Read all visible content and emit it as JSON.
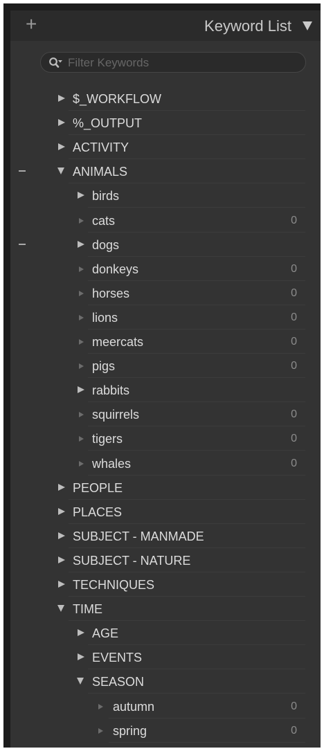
{
  "header": {
    "add_symbol": "+",
    "title": "Keyword List"
  },
  "search": {
    "placeholder": "Filter Keywords"
  },
  "keywords": [
    {
      "label": "$_WORKFLOW",
      "count": "",
      "depth": 0,
      "state": "collapsed",
      "collapse_mark": false
    },
    {
      "label": "%_OUTPUT",
      "count": "",
      "depth": 0,
      "state": "collapsed",
      "collapse_mark": false
    },
    {
      "label": "ACTIVITY",
      "count": "",
      "depth": 0,
      "state": "collapsed",
      "collapse_mark": false
    },
    {
      "label": "ANIMALS",
      "count": "",
      "depth": 0,
      "state": "expanded",
      "collapse_mark": true
    },
    {
      "label": "birds",
      "count": "",
      "depth": 1,
      "state": "collapsed",
      "collapse_mark": false
    },
    {
      "label": "cats",
      "count": "0",
      "depth": 1,
      "state": "leaf",
      "collapse_mark": false
    },
    {
      "label": "dogs",
      "count": "",
      "depth": 1,
      "state": "collapsed",
      "collapse_mark": true
    },
    {
      "label": "donkeys",
      "count": "0",
      "depth": 1,
      "state": "leaf",
      "collapse_mark": false
    },
    {
      "label": "horses",
      "count": "0",
      "depth": 1,
      "state": "leaf",
      "collapse_mark": false
    },
    {
      "label": "lions",
      "count": "0",
      "depth": 1,
      "state": "leaf",
      "collapse_mark": false
    },
    {
      "label": "meercats",
      "count": "0",
      "depth": 1,
      "state": "leaf",
      "collapse_mark": false
    },
    {
      "label": "pigs",
      "count": "0",
      "depth": 1,
      "state": "leaf",
      "collapse_mark": false
    },
    {
      "label": "rabbits",
      "count": "",
      "depth": 1,
      "state": "collapsed",
      "collapse_mark": false
    },
    {
      "label": "squirrels",
      "count": "0",
      "depth": 1,
      "state": "leaf",
      "collapse_mark": false
    },
    {
      "label": "tigers",
      "count": "0",
      "depth": 1,
      "state": "leaf",
      "collapse_mark": false
    },
    {
      "label": "whales",
      "count": "0",
      "depth": 1,
      "state": "leaf",
      "collapse_mark": false
    },
    {
      "label": "PEOPLE",
      "count": "",
      "depth": 0,
      "state": "collapsed",
      "collapse_mark": false
    },
    {
      "label": "PLACES",
      "count": "",
      "depth": 0,
      "state": "collapsed",
      "collapse_mark": false
    },
    {
      "label": "SUBJECT - MANMADE",
      "count": "",
      "depth": 0,
      "state": "collapsed",
      "collapse_mark": false
    },
    {
      "label": "SUBJECT - NATURE",
      "count": "",
      "depth": 0,
      "state": "collapsed",
      "collapse_mark": false
    },
    {
      "label": "TECHNIQUES",
      "count": "",
      "depth": 0,
      "state": "collapsed",
      "collapse_mark": false
    },
    {
      "label": "TIME",
      "count": "",
      "depth": 0,
      "state": "expanded",
      "collapse_mark": false
    },
    {
      "label": "AGE",
      "count": "",
      "depth": 1,
      "state": "collapsed",
      "collapse_mark": false
    },
    {
      "label": "EVENTS",
      "count": "",
      "depth": 1,
      "state": "collapsed",
      "collapse_mark": false
    },
    {
      "label": "SEASON",
      "count": "",
      "depth": 1,
      "state": "expanded",
      "collapse_mark": false
    },
    {
      "label": "autumn",
      "count": "0",
      "depth": 2,
      "state": "leaf",
      "collapse_mark": false
    },
    {
      "label": "spring",
      "count": "0",
      "depth": 2,
      "state": "leaf",
      "collapse_mark": false
    }
  ]
}
